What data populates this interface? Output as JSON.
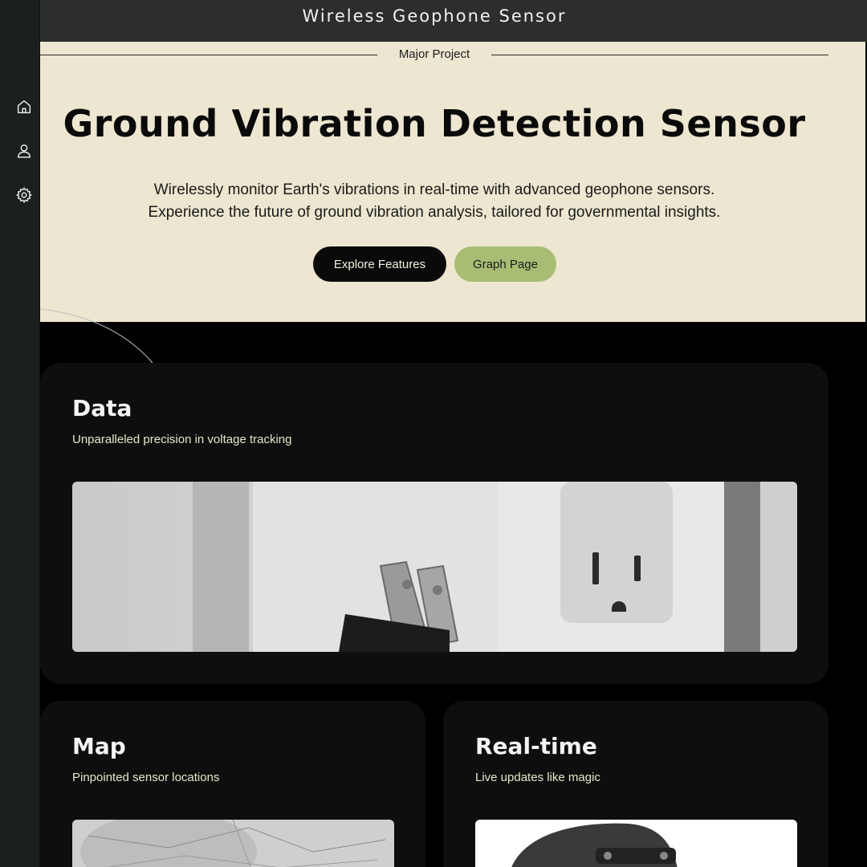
{
  "topbar": {
    "title": "Wireless Geophone Sensor"
  },
  "sidebar": {
    "items": [
      {
        "icon": "home-icon"
      },
      {
        "icon": "user-icon"
      },
      {
        "icon": "gear-icon"
      }
    ]
  },
  "hero": {
    "eyebrow": "Major Project",
    "title": "Ground Vibration Detection Sensor",
    "subtitle_line1": "Wirelessly monitor Earth's vibrations in real-time with advanced geophone sensors.",
    "subtitle_line2": "Experience the future of ground vibration analysis, tailored for governmental insights.",
    "primary_button": "Explore Features",
    "secondary_button": "Graph Page"
  },
  "cards": {
    "data": {
      "title": "Data",
      "subtitle": "Unparalleled precision in voltage tracking"
    },
    "map": {
      "title": "Map",
      "subtitle": "Pinpointed sensor locations"
    },
    "realtime": {
      "title": "Real-time",
      "subtitle": "Live updates like magic"
    }
  },
  "colors": {
    "hero_background": "#ede6d0",
    "accent_green": "#a8bd74",
    "card_background": "#0e0e0e",
    "topbar_background": "#2b2e2d"
  }
}
